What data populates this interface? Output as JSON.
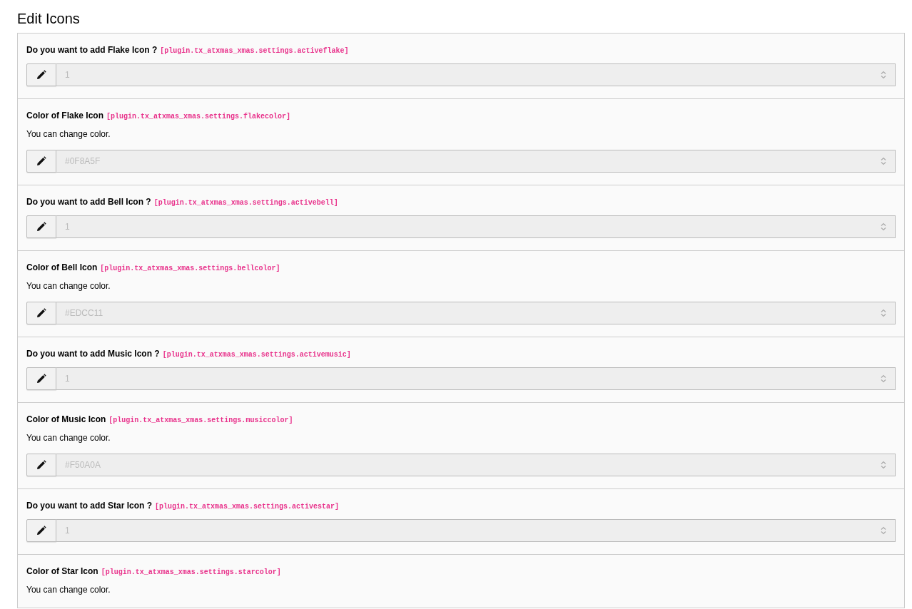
{
  "title": "Edit Icons",
  "settings": [
    {
      "label": "Do you want to add Flake Icon ?",
      "key": "[plugin.tx_atxmas_xmas.settings.activeflake]",
      "value": "1"
    },
    {
      "label": "Color of Flake Icon",
      "key": "[plugin.tx_atxmas_xmas.settings.flakecolor]",
      "description": "You can change color.",
      "value": "#0F8A5F"
    },
    {
      "label": "Do you want to add Bell Icon ?",
      "key": "[plugin.tx_atxmas_xmas.settings.activebell]",
      "value": "1"
    },
    {
      "label": "Color of Bell Icon",
      "key": "[plugin.tx_atxmas_xmas.settings.bellcolor]",
      "description": "You can change color.",
      "value": "#EDCC11"
    },
    {
      "label": "Do you want to add Music Icon ?",
      "key": "[plugin.tx_atxmas_xmas.settings.activemusic]",
      "value": "1"
    },
    {
      "label": "Color of Music Icon",
      "key": "[plugin.tx_atxmas_xmas.settings.musiccolor]",
      "description": "You can change color.",
      "value": "#F50A0A"
    },
    {
      "label": "Do you want to add Star Icon ?",
      "key": "[plugin.tx_atxmas_xmas.settings.activestar]",
      "value": "1"
    },
    {
      "label": "Color of Star Icon",
      "key": "[plugin.tx_atxmas_xmas.settings.starcolor]",
      "description": "You can change color."
    }
  ]
}
